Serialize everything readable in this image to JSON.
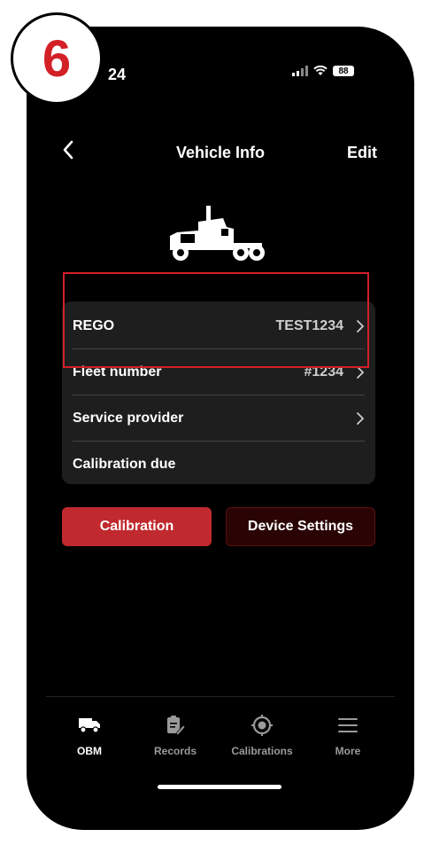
{
  "step_badge": "6",
  "status_bar": {
    "time": "24",
    "battery": "88"
  },
  "nav": {
    "title": "Vehicle Info",
    "edit_label": "Edit"
  },
  "vehicle_details": [
    {
      "label": "REGO",
      "value": "TEST1234",
      "has_chevron": true
    },
    {
      "label": "Fleet number",
      "value": "#1234",
      "has_chevron": true
    },
    {
      "label": "Service provider",
      "value": "",
      "has_chevron": true
    },
    {
      "label": "Calibration due",
      "value": "",
      "has_chevron": false
    }
  ],
  "buttons": {
    "calibration": "Calibration",
    "device_settings": "Device Settings"
  },
  "tab_bar": [
    {
      "label": "OBM",
      "icon": "truck-icon",
      "active": true
    },
    {
      "label": "Records",
      "icon": "clipboard-edit-icon",
      "active": false
    },
    {
      "label": "Calibrations",
      "icon": "target-gear-icon",
      "active": false
    },
    {
      "label": "More",
      "icon": "hamburger-menu-icon",
      "active": false
    }
  ],
  "colors": {
    "accent_red": "#c0292e",
    "highlight_red": "#d32027",
    "device_btn_bg": "#2a0404",
    "card_bg": "#1e1e1e"
  }
}
